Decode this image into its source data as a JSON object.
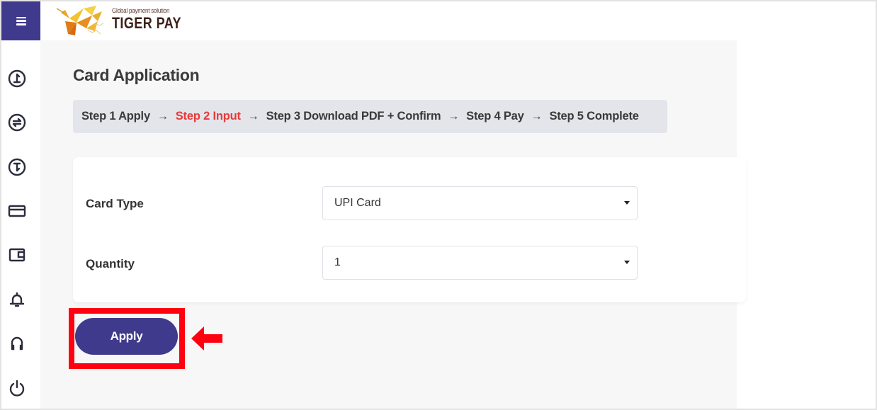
{
  "header": {
    "menu_icon": "hamburger-menu-icon",
    "logo": {
      "tagline": "Global payment solution",
      "brand": "TIGER PAY"
    }
  },
  "sidebar": {
    "items": [
      {
        "icon": "deposit-icon"
      },
      {
        "icon": "transfer-icon"
      },
      {
        "icon": "withdraw-icon"
      },
      {
        "icon": "card-icon"
      },
      {
        "icon": "wallet-icon"
      },
      {
        "icon": "bell-icon"
      },
      {
        "icon": "headphones-icon"
      },
      {
        "icon": "power-icon"
      }
    ]
  },
  "main": {
    "title": "Card Application",
    "steps": [
      {
        "label": "Step 1 Apply",
        "active": false
      },
      {
        "label": "Step 2 Input",
        "active": true
      },
      {
        "label": "Step 3 Download PDF + Confirm",
        "active": false
      },
      {
        "label": "Step 4 Pay",
        "active": false
      },
      {
        "label": "Step 5 Complete",
        "active": false
      }
    ],
    "step_arrow": "→",
    "form": {
      "card_type": {
        "label": "Card Type",
        "value": "UPI Card"
      },
      "quantity": {
        "label": "Quantity",
        "value": "1"
      }
    },
    "apply_label": "Apply"
  },
  "colors": {
    "brand": "#3f3a8c",
    "active_step": "#e83b3b",
    "annotation": "#ff0011"
  }
}
